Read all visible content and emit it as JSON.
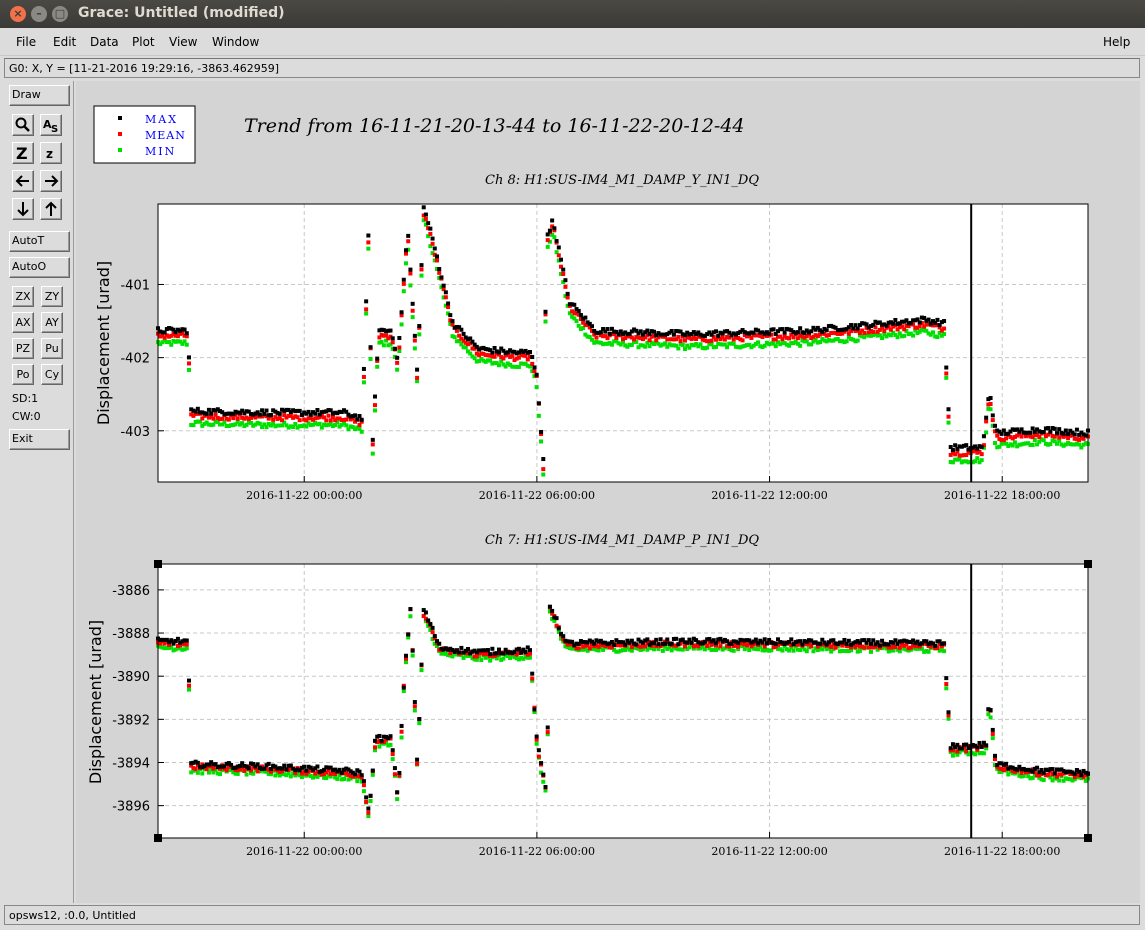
{
  "window": {
    "title": "Grace: Untitled (modified)"
  },
  "menu": {
    "file": "File",
    "edit": "Edit",
    "data": "Data",
    "plot": "Plot",
    "view": "View",
    "window": "Window",
    "help": "Help"
  },
  "locator": "G0: X, Y = [11-21-2016 19:29:16, -3863.462959]",
  "toolbar": {
    "draw": "Draw",
    "autot": "AutoT",
    "autoo": "AutoO",
    "zx": "ZX",
    "zy": "ZY",
    "ax": "AX",
    "ay": "AY",
    "pz": "PZ",
    "pu": "Pu",
    "po": "Po",
    "cy": "Cy",
    "sd": "SD:1",
    "cw": "CW:0",
    "exit": "Exit",
    "icons": {
      "zoom": "magnifier-icon",
      "autoscale": "autoscale-icon",
      "zoom_in": "zoom-z-icon",
      "zoom_out": "zoom-small-z-icon",
      "left": "arrow-left-icon",
      "right": "arrow-right-icon",
      "down": "arrow-down-icon",
      "up": "arrow-up-icon"
    }
  },
  "status": "opsws12, :0.0, Untitled",
  "colors": {
    "max": "#000000",
    "mean": "#ff0000",
    "min": "#00e000",
    "legend_text": "#0000ff"
  },
  "main_title": "Trend from 16-11-21-20-13-44 to 16-11-22-20-12-44",
  "chart_data": [
    {
      "type": "scatter",
      "title": "Ch 8: H1:SUS-IM4_M1_DAMP_Y_IN1_DQ",
      "xlabel": "",
      "ylabel": "Displacement [urad]",
      "x_ticks": [
        "2016-11-22 00:00:00",
        "2016-11-22 06:00:00",
        "2016-11-22 12:00:00",
        "2016-11-22 18:00:00"
      ],
      "xlim": [
        "2016-11-21 20:13:44",
        "2016-11-22 20:12:44"
      ],
      "y_ticks": [
        -401,
        -402,
        -403
      ],
      "ylim": [
        -403.7,
        -399.9
      ],
      "marker_line": "2016-11-22 17:12:00",
      "legend": [
        "MAX",
        "MEAN",
        "MIN"
      ],
      "series_offsets": {
        "MAX": 0.07,
        "MEAN": 0.0,
        "MIN": -0.1
      },
      "mean_trace": [
        [
          "2016-11-21 20:13:44",
          -401.7
        ],
        [
          "2016-11-21 21:00:00",
          -401.7
        ],
        [
          "2016-11-21 21:05:00",
          -402.8
        ],
        [
          "2016-11-21 23:00:00",
          -402.82
        ],
        [
          "2016-11-22 01:00:00",
          -402.82
        ],
        [
          "2016-11-22 01:30:00",
          -402.9
        ],
        [
          "2016-11-22 01:40:00",
          -400.2
        ],
        [
          "2016-11-22 01:45:00",
          -403.4
        ],
        [
          "2016-11-22 01:55:00",
          -401.7
        ],
        [
          "2016-11-22 02:15:00",
          -401.7
        ],
        [
          "2016-11-22 02:25:00",
          -402.1
        ],
        [
          "2016-11-22 02:40:00",
          -400.3
        ],
        [
          "2016-11-22 02:55:00",
          -402.3
        ],
        [
          "2016-11-22 03:05:00",
          -400.0
        ],
        [
          "2016-11-22 03:20:00",
          -400.5
        ],
        [
          "2016-11-22 03:50:00",
          -401.6
        ],
        [
          "2016-11-22 04:30:00",
          -401.95
        ],
        [
          "2016-11-22 05:30:00",
          -402.0
        ],
        [
          "2016-11-22 05:50:00",
          -402.0
        ],
        [
          "2016-11-22 06:00:00",
          -402.3
        ],
        [
          "2016-11-22 06:10:00",
          -403.5
        ],
        [
          "2016-11-22 06:15:00",
          -400.4
        ],
        [
          "2016-11-22 06:25:00",
          -400.2
        ],
        [
          "2016-11-22 06:50:00",
          -401.3
        ],
        [
          "2016-11-22 07:30:00",
          -401.7
        ],
        [
          "2016-11-22 10:00:00",
          -401.75
        ],
        [
          "2016-11-22 13:00:00",
          -401.7
        ],
        [
          "2016-11-22 16:00:00",
          -401.55
        ],
        [
          "2016-11-22 16:30:00",
          -401.6
        ],
        [
          "2016-11-22 16:40:00",
          -403.3
        ],
        [
          "2016-11-22 17:30:00",
          -403.3
        ],
        [
          "2016-11-22 17:40:00",
          -402.5
        ],
        [
          "2016-11-22 17:50:00",
          -403.1
        ],
        [
          "2016-11-22 19:00:00",
          -403.05
        ],
        [
          "2016-11-22 20:12:44",
          -403.1
        ]
      ]
    },
    {
      "type": "scatter",
      "title": "Ch 7: H1:SUS-IM4_M1_DAMP_P_IN1_DQ",
      "xlabel": "",
      "ylabel": "Displacement [urad]",
      "x_ticks": [
        "2016-11-22 00:00:00",
        "2016-11-22 06:00:00",
        "2016-11-22 12:00:00",
        "2016-11-22 18:00:00"
      ],
      "xlim": [
        "2016-11-21 20:13:44",
        "2016-11-22 20:12:44"
      ],
      "y_ticks": [
        -3886,
        -3888,
        -3890,
        -3892,
        -3894,
        -3896
      ],
      "ylim": [
        -3897.5,
        -3884.8
      ],
      "marker_line": "2016-11-22 17:12:00",
      "legend": [
        "MAX",
        "MEAN",
        "MIN"
      ],
      "series_offsets": {
        "MAX": 0.12,
        "MEAN": 0.0,
        "MIN": -0.18
      },
      "mean_trace": [
        [
          "2016-11-21 20:13:44",
          -3888.5
        ],
        [
          "2016-11-21 21:00:00",
          -3888.5
        ],
        [
          "2016-11-21 21:05:00",
          -3894.2
        ],
        [
          "2016-11-21 23:00:00",
          -3894.3
        ],
        [
          "2016-11-22 01:00:00",
          -3894.5
        ],
        [
          "2016-11-22 01:30:00",
          -3894.6
        ],
        [
          "2016-11-22 01:40:00",
          -3896.5
        ],
        [
          "2016-11-22 01:50:00",
          -3893.0
        ],
        [
          "2016-11-22 02:15:00",
          -3893.0
        ],
        [
          "2016-11-22 02:25:00",
          -3895.8
        ],
        [
          "2016-11-22 02:35:00",
          -3890.0
        ],
        [
          "2016-11-22 02:45:00",
          -3886.8
        ],
        [
          "2016-11-22 02:55:00",
          -3894.3
        ],
        [
          "2016-11-22 03:05:00",
          -3887.0
        ],
        [
          "2016-11-22 03:30:00",
          -3888.8
        ],
        [
          "2016-11-22 04:30:00",
          -3889.0
        ],
        [
          "2016-11-22 05:50:00",
          -3888.9
        ],
        [
          "2016-11-22 06:00:00",
          -3893.2
        ],
        [
          "2016-11-22 06:15:00",
          -3895.5
        ],
        [
          "2016-11-22 06:20:00",
          -3886.8
        ],
        [
          "2016-11-22 06:45:00",
          -3888.6
        ],
        [
          "2016-11-22 10:00:00",
          -3888.5
        ],
        [
          "2016-11-22 16:30:00",
          -3888.6
        ],
        [
          "2016-11-22 16:40:00",
          -3893.4
        ],
        [
          "2016-11-22 17:35:00",
          -3893.3
        ],
        [
          "2016-11-22 17:40:00",
          -3891.0
        ],
        [
          "2016-11-22 17:50:00",
          -3894.2
        ],
        [
          "2016-11-22 19:00:00",
          -3894.5
        ],
        [
          "2016-11-22 20:12:44",
          -3894.6
        ]
      ]
    }
  ]
}
